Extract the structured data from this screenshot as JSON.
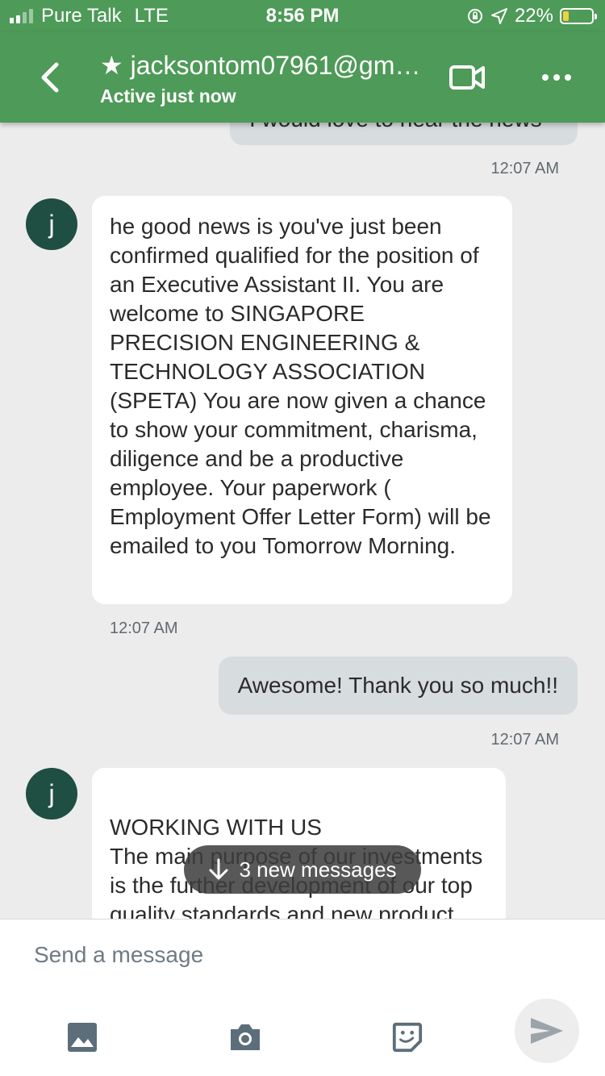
{
  "status_bar": {
    "carrier": "Pure Talk",
    "network": "LTE",
    "time": "8:56 PM",
    "battery_percent": "22%",
    "battery_level": 0.22
  },
  "header": {
    "title": "★ jacksontom07961@gm…",
    "subtitle": "Active just now",
    "icons": [
      "back-arrow-icon",
      "video-call-icon",
      "more-options-icon"
    ]
  },
  "messages": [
    {
      "direction": "out",
      "text": "I would love to hear the news",
      "time": "12:07 AM"
    },
    {
      "direction": "in",
      "avatar": "j",
      "text": "he good news is you've just been confirmed qualified for the position of an Executive Assistant II. You are welcome to SINGAPORE PRECISION ENGINEERING & TECHNOLOGY  ASSOCIATION (SPETA) You are now given a chance to show your commitment, charisma, diligence and be a productive employee. Your paperwork ( Employment Offer Letter Form) will be emailed to you Tomorrow Morning.",
      "time": "12:07 AM"
    },
    {
      "direction": "out",
      "text": "Awesome! Thank you so much!!",
      "time": "12:07 AM"
    },
    {
      "direction": "in",
      "avatar": "j",
      "text": "WORKING WITH US\nThe main purpose of our investments is the further development of our top quality standards and new product"
    }
  ],
  "new_messages_pill": "3 new messages",
  "composer": {
    "placeholder": "Send a message",
    "icons": [
      "image-icon",
      "camera-icon",
      "sticker-icon",
      "send-icon"
    ]
  },
  "colors": {
    "header_green": "#4e9a58",
    "avatar": "#1f4e42",
    "out_bubble": "#d7dcdf",
    "background": "#ececec"
  }
}
